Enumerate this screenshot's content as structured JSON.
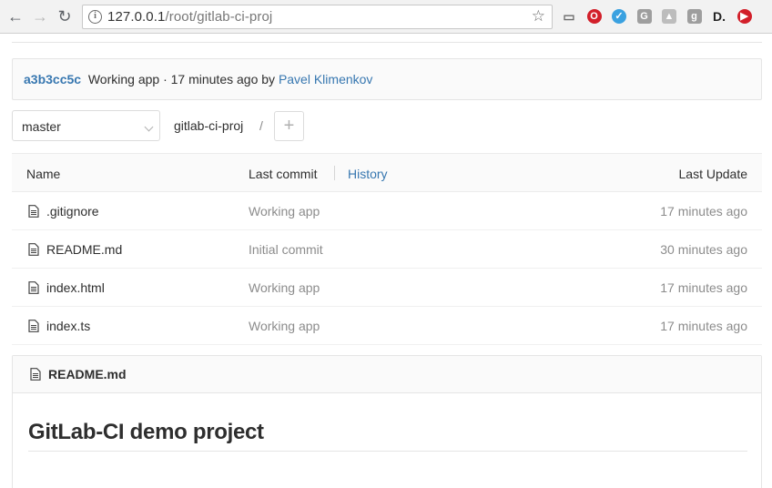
{
  "browser": {
    "url_host": "127.0.0.1",
    "url_path": "/root/gitlab-ci-proj",
    "extensions": [
      {
        "name": "cast-icon",
        "color": "#6b6b6b",
        "glyph": "▭"
      },
      {
        "name": "opera-icon",
        "color": "#d21f2a",
        "glyph": "O"
      },
      {
        "name": "checkmark-icon",
        "color": "#3aa1e0",
        "glyph": "✓"
      },
      {
        "name": "google-translate-icon",
        "color": "#9e9e9e",
        "glyph": "G"
      },
      {
        "name": "drive-icon",
        "color": "#bdbdbd",
        "glyph": "▲"
      },
      {
        "name": "puzzle-icon",
        "color": "#9e9e9e",
        "glyph": "g"
      },
      {
        "name": "d-icon",
        "color": "#222222",
        "glyph": "D."
      },
      {
        "name": "record-icon",
        "color": "#d21f2a",
        "glyph": "▶"
      }
    ]
  },
  "commit": {
    "sha": "a3b3cc5c",
    "message": "Working app",
    "meta": " · 17 minutes ago by ",
    "author": "Pavel Klimenkov"
  },
  "branch": {
    "selected": "master"
  },
  "breadcrumb": {
    "project": "gitlab-ci-proj",
    "separator": "/",
    "add_label": "+"
  },
  "tree": {
    "columns": {
      "name": "Name",
      "last_commit": "Last commit",
      "history": "History",
      "last_update": "Last Update"
    },
    "rows": [
      {
        "name": ".gitignore",
        "commit": "Working app",
        "date": "17 minutes ago"
      },
      {
        "name": "README.md",
        "commit": "Initial commit",
        "date": "30 minutes ago"
      },
      {
        "name": "index.html",
        "commit": "Working app",
        "date": "17 minutes ago"
      },
      {
        "name": "index.ts",
        "commit": "Working app",
        "date": "17 minutes ago"
      }
    ]
  },
  "readme": {
    "file": "README.md",
    "heading": "GitLab-CI demo project"
  }
}
